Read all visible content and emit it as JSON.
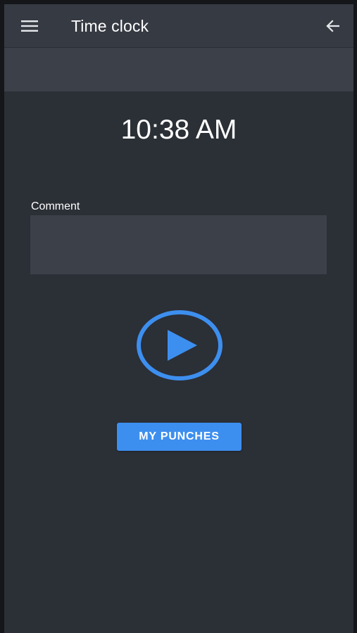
{
  "appbar": {
    "title": "Time clock",
    "menu_icon": "hamburger-menu-icon",
    "back_icon": "arrow-left-icon"
  },
  "clock": {
    "time": "10:38 AM"
  },
  "comment": {
    "label": "Comment",
    "value": "",
    "placeholder": ""
  },
  "punch": {
    "icon": "play-circle-icon"
  },
  "my_punches": {
    "label": "MY PUNCHES"
  },
  "colors": {
    "background": "#2b2f36",
    "appbar": "#363a42",
    "surface": "#3b4049",
    "accent": "#3d8fef",
    "text": "#ffffff"
  }
}
